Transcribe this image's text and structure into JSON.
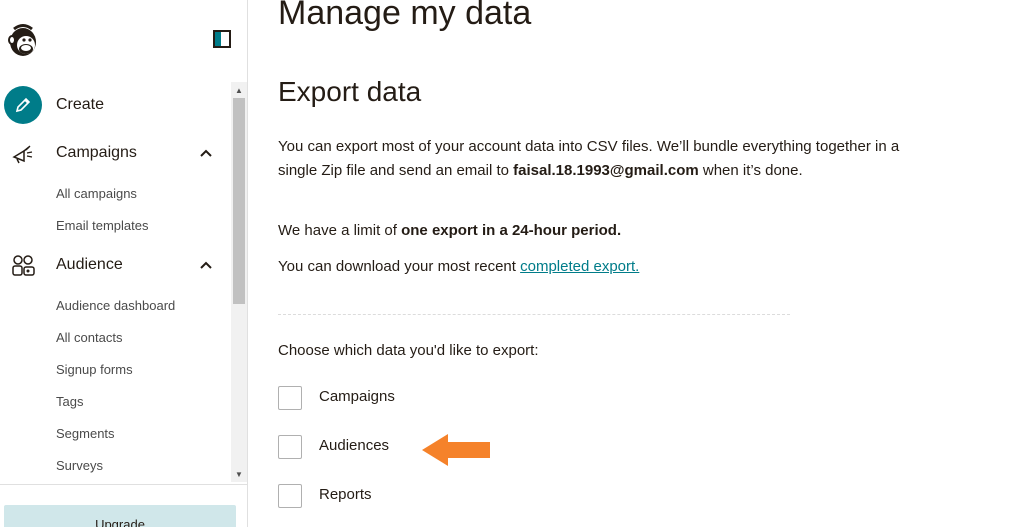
{
  "sidebar": {
    "logo_icon": "mailchimp-freddie-logo",
    "toggle_icon": "sidebar-toggle-icon",
    "nav": [
      {
        "label": "Create",
        "icon": "pencil-icon",
        "expanded": false
      },
      {
        "label": "Campaigns",
        "icon": "megaphone-icon",
        "expanded": true,
        "children": [
          "All campaigns",
          "Email templates"
        ]
      },
      {
        "label": "Audience",
        "icon": "audience-icon",
        "expanded": true,
        "children": [
          "Audience dashboard",
          "All contacts",
          "Signup forms",
          "Tags",
          "Segments",
          "Surveys"
        ]
      }
    ],
    "upgrade_label": "Upgrade"
  },
  "main": {
    "page_title": "Manage my data",
    "section_title": "Export data",
    "intro": {
      "part1": "You can export most of your account data into CSV files. We’ll bundle everything together in a single Zip file and send an email to ",
      "email": "faisal.18.1993@gmail.com",
      "part2": " when it’s done."
    },
    "limit": {
      "part1": "We have a limit of ",
      "bold": "one export in a 24-hour period."
    },
    "download": {
      "part1": "You can download your most recent ",
      "link": "completed export."
    },
    "choose_label": "Choose which data you'd like to export:",
    "options": [
      {
        "label": "Campaigns",
        "checked": false
      },
      {
        "label": "Audiences",
        "checked": false
      },
      {
        "label": "Reports",
        "checked": false
      }
    ]
  },
  "colors": {
    "accent": "#007c89",
    "annotation_arrow": "#f5822a",
    "upgrade_bg": "#d0e7ea"
  }
}
